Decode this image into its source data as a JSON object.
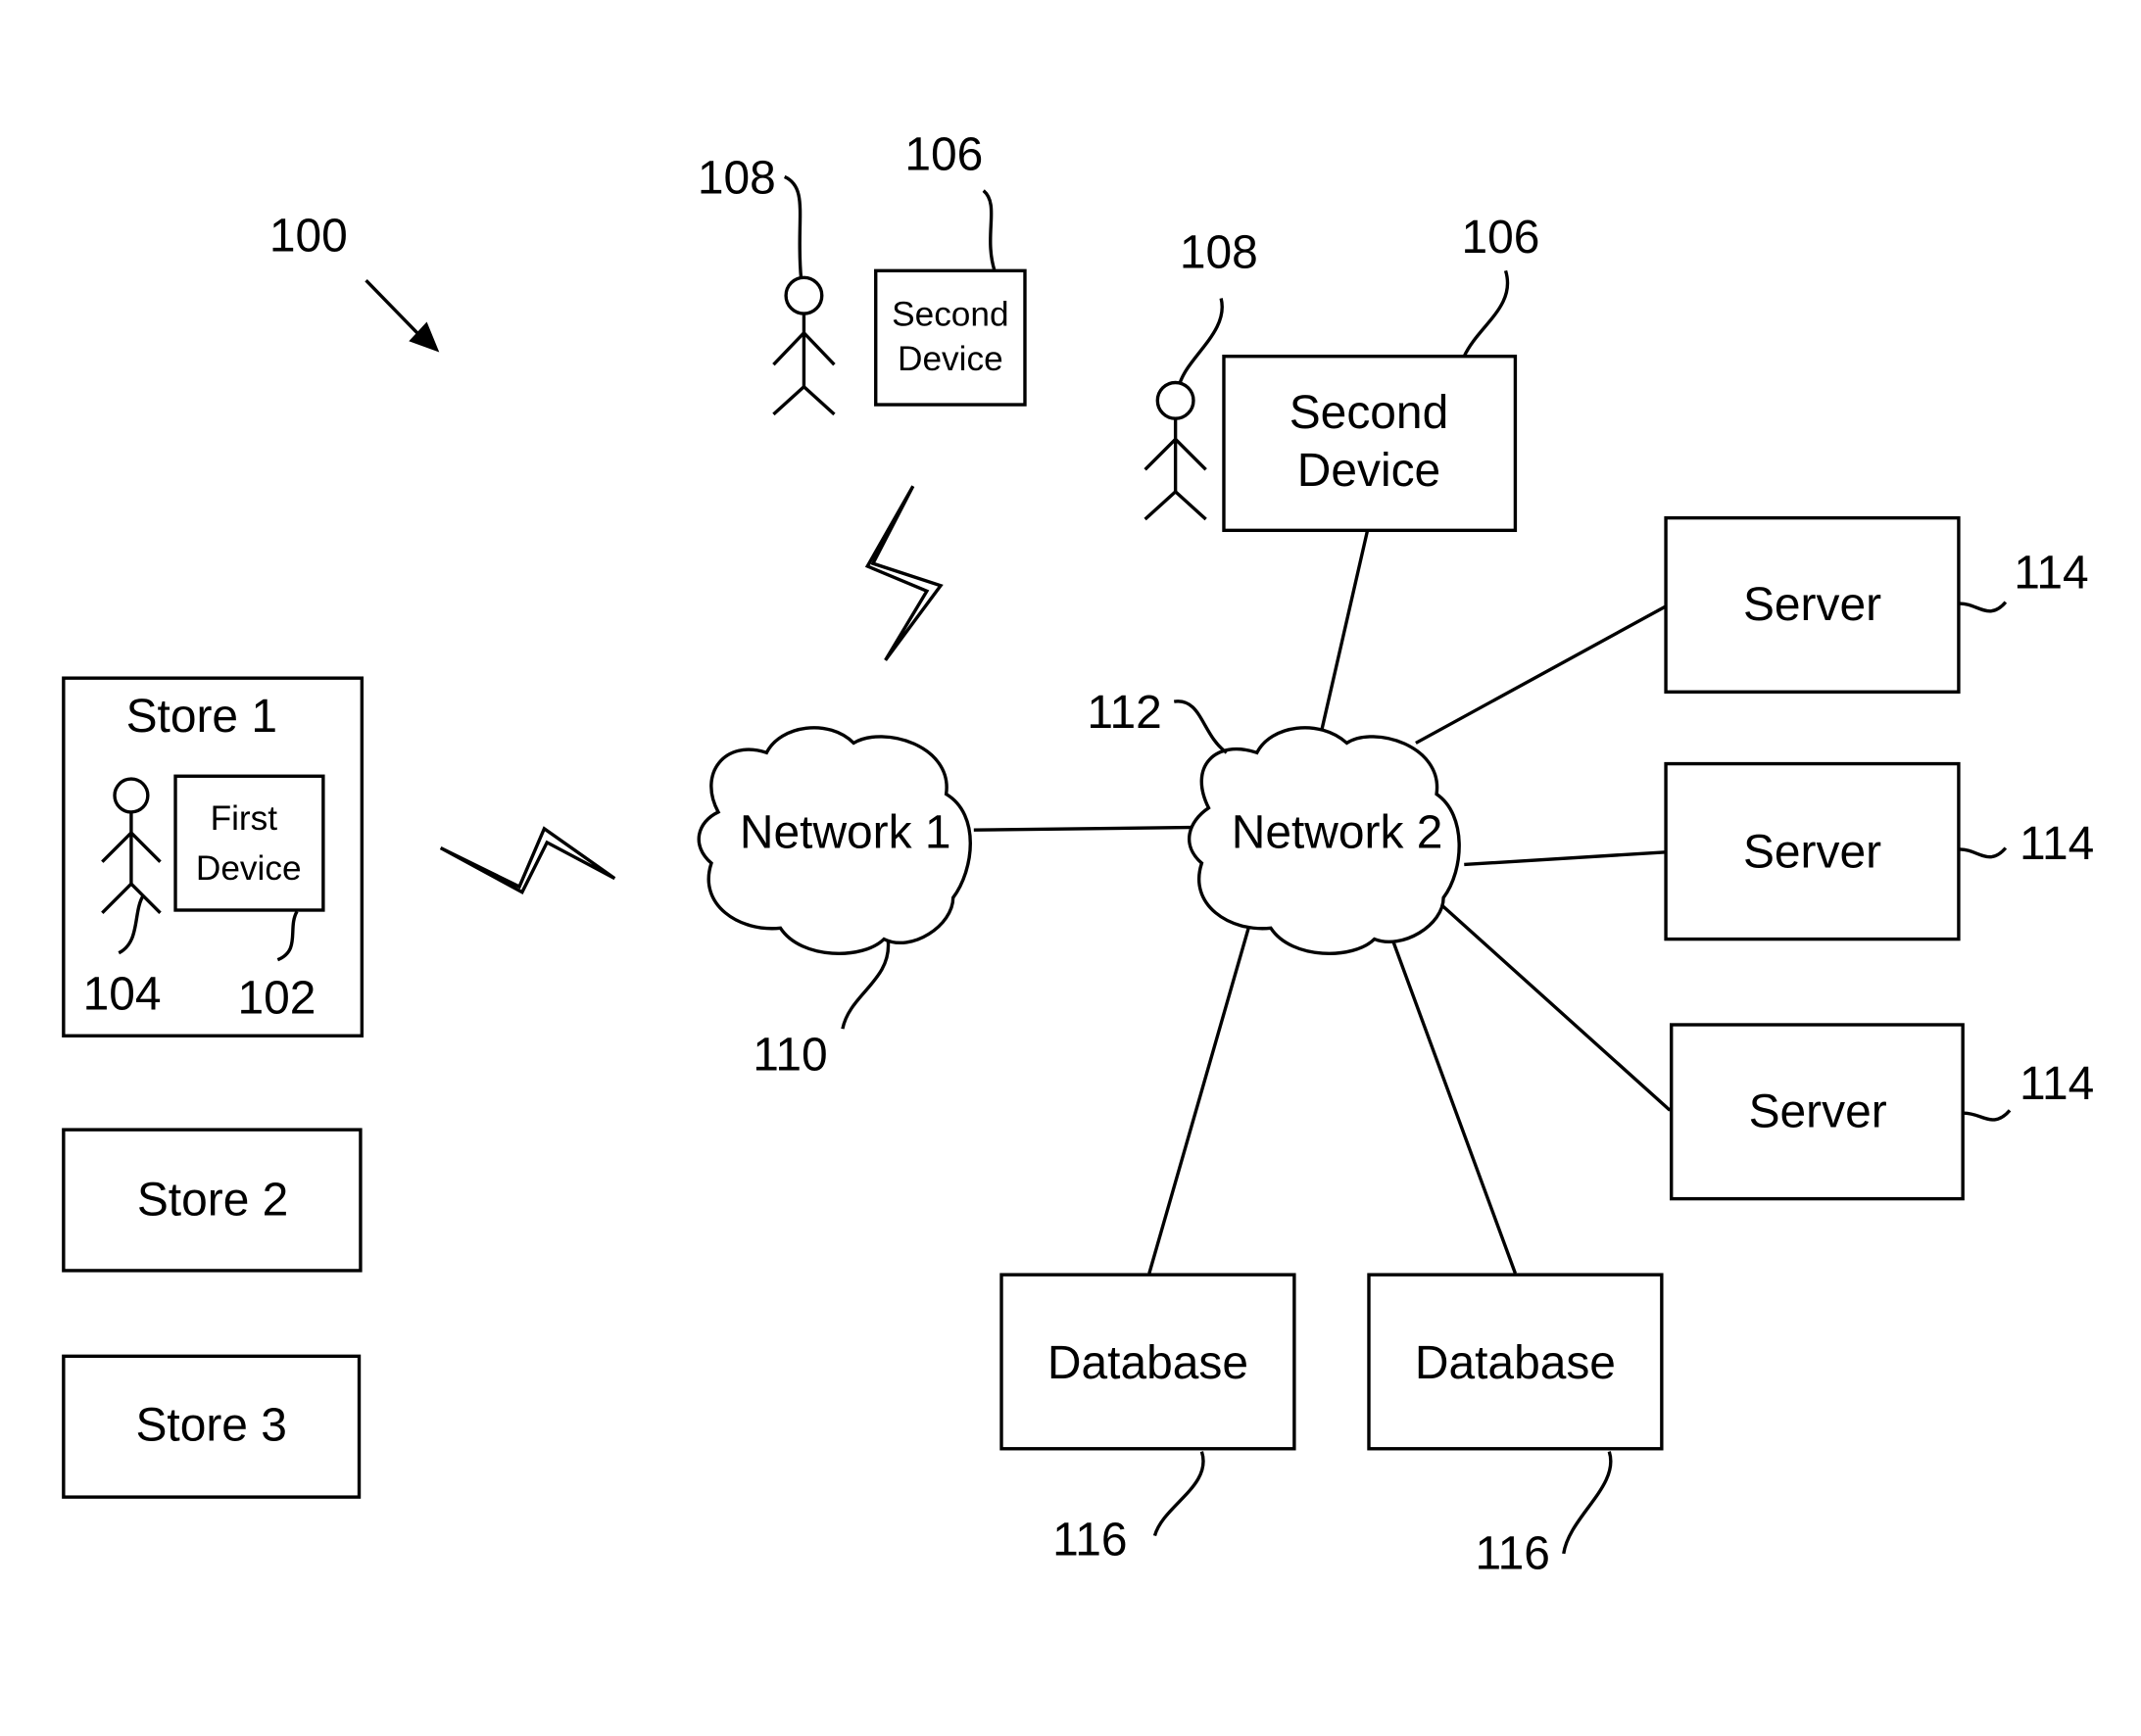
{
  "figure": {
    "system_ref": "100",
    "colors": {
      "stroke": "#000000",
      "background": "#ffffff"
    }
  },
  "stores": [
    {
      "label": "Store 1",
      "first_device": "First Device",
      "user_ref": "104",
      "device_ref": "102"
    },
    {
      "label": "Store 2"
    },
    {
      "label": "Store 3"
    }
  ],
  "second_device_small": {
    "line1": "Second",
    "line2": "Device",
    "device_ref": "106",
    "user_ref": "108"
  },
  "second_device_large": {
    "line1": "Second",
    "line2": "Device",
    "device_ref": "106",
    "user_ref": "108"
  },
  "networks": [
    {
      "label": "Network 1",
      "ref": "110"
    },
    {
      "label": "Network 2",
      "ref": "112"
    }
  ],
  "servers": [
    {
      "label": "Server",
      "ref": "114"
    },
    {
      "label": "Server",
      "ref": "114"
    },
    {
      "label": "Server",
      "ref": "114"
    }
  ],
  "databases": [
    {
      "label": "Database",
      "ref": "116"
    },
    {
      "label": "Database",
      "ref": "116"
    }
  ],
  "icons": {
    "user": "stick-figure",
    "wireless": "lightning-bolt",
    "network": "cloud",
    "pointer": "arrow"
  }
}
